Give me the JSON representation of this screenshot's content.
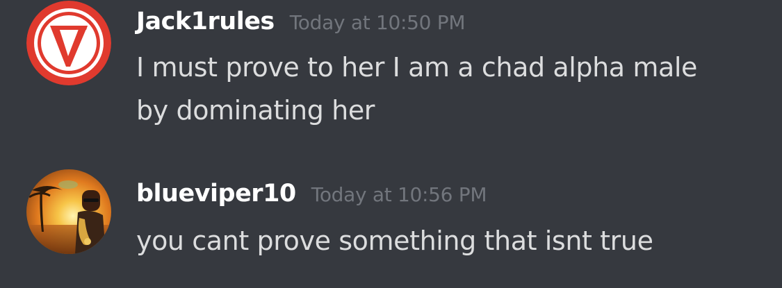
{
  "messages": [
    {
      "username": "Jack1rules",
      "timestamp": "Today at 10:50 PM",
      "lines": [
        "I must prove to her I am a chad alpha male",
        "by dominating her"
      ],
      "avatar": "red-circle-v-logo"
    },
    {
      "username": "blueviper10",
      "timestamp": "Today at 10:56 PM",
      "lines": [
        "you cant prove something that isnt true"
      ],
      "avatar": "sunset-saxophone-photo"
    }
  ],
  "colors": {
    "background": "#36393f",
    "username": "#ffffff",
    "timestamp": "#72767d",
    "message_text": "#dcddde",
    "avatar_red": "#e03a2e"
  }
}
